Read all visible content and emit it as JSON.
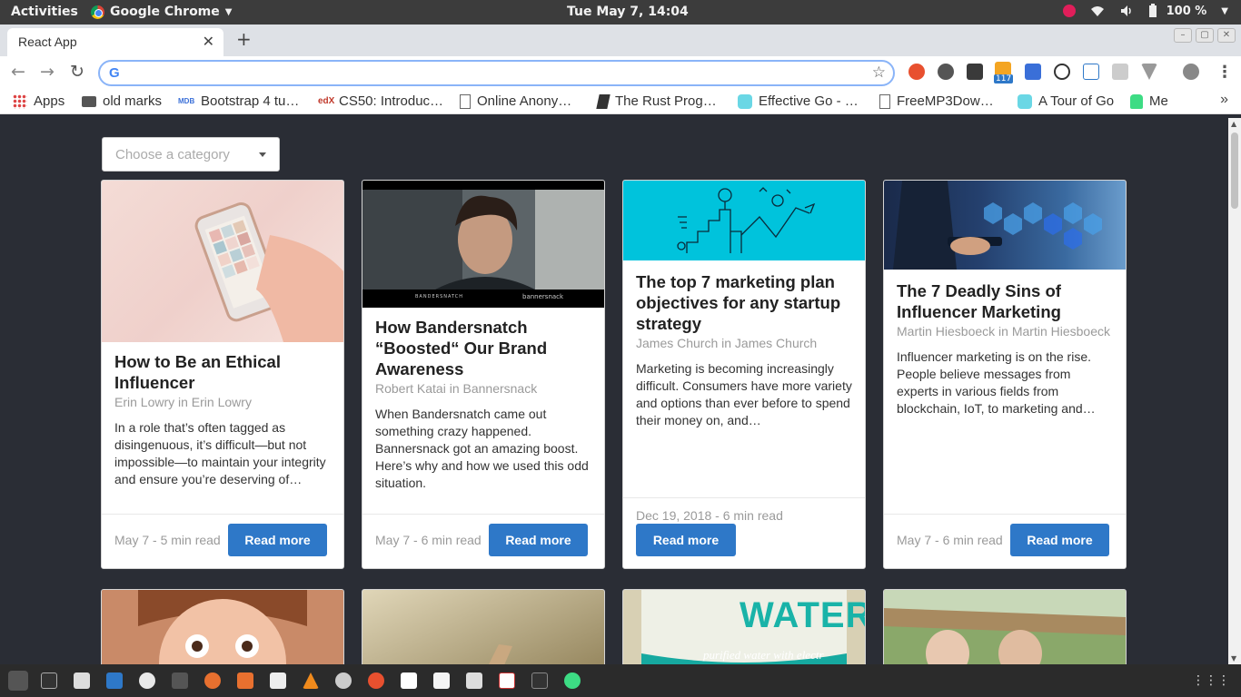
{
  "system_bar": {
    "activities": "Activities",
    "app_name": "Google Chrome",
    "clock": "Tue May  7, 14:04",
    "battery": "100 %"
  },
  "browser": {
    "tab_title": "React App",
    "tab_close": "✕",
    "new_tab": "+",
    "omnibox_value": "",
    "extension_badge": "117"
  },
  "bookmarks": [
    {
      "label": "Apps",
      "icon": "apps-grid-icon"
    },
    {
      "label": "old marks",
      "icon": "folder-icon"
    },
    {
      "label": "Bootstrap 4 tu…",
      "icon": "mdb-icon"
    },
    {
      "label": "CS50: Introduc…",
      "icon": "edx-icon"
    },
    {
      "label": "Online Anony…",
      "icon": "page-icon"
    },
    {
      "label": "The Rust Prog…",
      "icon": "book-icon"
    },
    {
      "label": "Effective Go - …",
      "icon": "gopher-icon"
    },
    {
      "label": "FreeMP3Dow…",
      "icon": "page-icon"
    },
    {
      "label": "A Tour of Go",
      "icon": "gopher-icon"
    },
    {
      "label": "Me",
      "icon": "android-icon"
    }
  ],
  "filter": {
    "placeholder": "Choose a category"
  },
  "cards": [
    {
      "title": "How to Be an Ethical Influencer",
      "meta": "Erin Lowry in Erin Lowry",
      "excerpt": "In a role that’s often tagged as disingenuous, it’s difficult—but not impossible—to maintain your integrity and ensure you’re deserving of…",
      "date": "May 7 - 5 min read",
      "button": "Read more",
      "image": "hand-holding-phone"
    },
    {
      "title": "How Bandersnatch “Boosted“ Our Brand Awareness",
      "meta": "Robert Katai in Bannersnack",
      "excerpt": "When Bandersnatch came out something crazy happened. Bannersnack got an amazing boost. Here’s why and how we used this odd situation.",
      "date": "May 7 - 6 min read",
      "button": "Read more",
      "image": "bandersnatch-still",
      "image_text_left": "BANDERSNATCH",
      "image_text_right": "bannersnack"
    },
    {
      "title": "The top 7 marketing plan objectives for any startup strategy",
      "meta": "James Church in James Church",
      "excerpt": "Marketing is becoming increasingly difficult. Consumers have more variety and options than ever before to spend their money on, and…",
      "date": "Dec 19, 2018 - 6 min read",
      "button": "Read more",
      "image": "marketing-illustration"
    },
    {
      "title": "The 7 Deadly Sins of Influencer Marketing",
      "meta": "Martin Hiesboeck in Martin Hiesboeck",
      "excerpt": "Influencer marketing is on the rise. People believe messages from experts in various fields from blockchain, IoT, to marketing and…",
      "date": "May 7 - 6 min read",
      "button": "Read more",
      "image": "businessman-hexagons"
    }
  ],
  "second_row": [
    {
      "image": "surprised-child"
    },
    {
      "image": "sunlit-hand"
    },
    {
      "image": "water-bottle",
      "text": "WATER",
      "subtext": "purified water with electr"
    },
    {
      "image": "people-outdoors"
    }
  ],
  "colors": {
    "page_bg": "#2a2d35",
    "button": "#2e78c8",
    "meta_text": "#9a9a9a"
  }
}
